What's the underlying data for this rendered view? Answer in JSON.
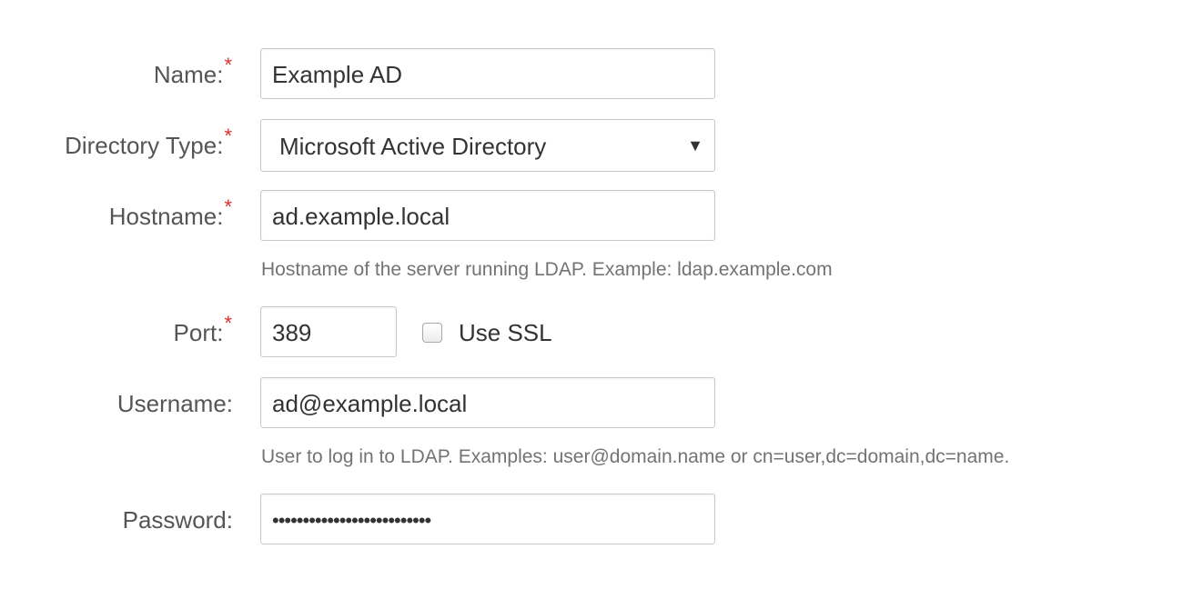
{
  "form": {
    "name": {
      "label": "Name:",
      "required_marker": "*",
      "value": "Example AD"
    },
    "directory_type": {
      "label": "Directory Type:",
      "required_marker": "*",
      "selected": "Microsoft Active Directory",
      "arrow_icon": "▼"
    },
    "hostname": {
      "label": "Hostname:",
      "required_marker": "*",
      "value": "ad.example.local",
      "help": "Hostname of the server running LDAP. Example: ldap.example.com"
    },
    "port": {
      "label": "Port:",
      "required_marker": "*",
      "value": "389",
      "use_ssl_label": "Use SSL",
      "use_ssl_checked": false
    },
    "username": {
      "label": "Username:",
      "value": "ad@example.local",
      "help": "User to log in to LDAP. Examples: user@domain.name or cn=user,dc=domain,dc=name."
    },
    "password": {
      "label": "Password:",
      "masked_value": "••••••••••••••••••••••••••"
    }
  },
  "colors": {
    "required": "#d9302c",
    "label": "#555555",
    "help": "#737373",
    "border": "#c8c8c8"
  }
}
